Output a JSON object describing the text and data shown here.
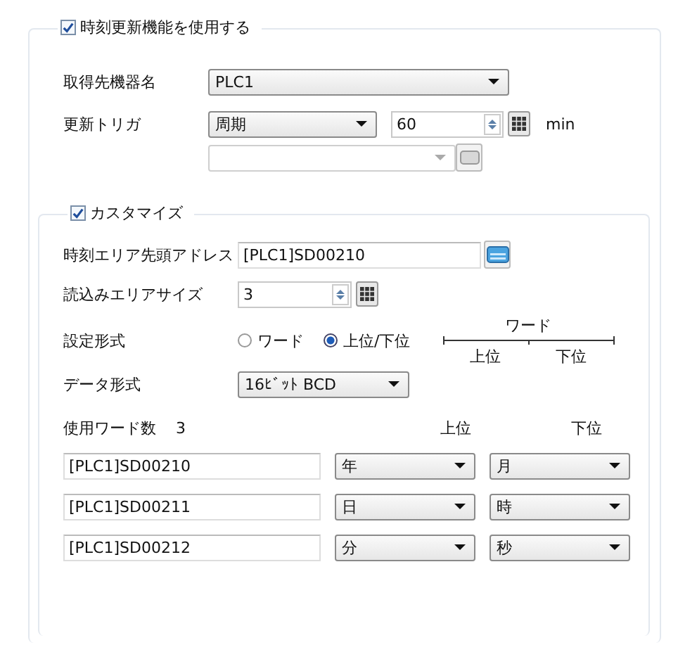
{
  "time_update": {
    "label": "時刻更新機能を使用する",
    "checked": true,
    "source_device": {
      "label": "取得先機器名",
      "value": "PLC1"
    },
    "trigger": {
      "label": "更新トリガ",
      "value": "周期",
      "interval": "60",
      "unit": "min",
      "secondary_disabled": true
    },
    "customize": {
      "label": "カスタマイズ",
      "checked": true,
      "start_address": {
        "label": "時刻エリア先頭アドレス",
        "value": "[PLC1]SD00210"
      },
      "read_size": {
        "label": "読込みエリアサイズ",
        "value": "3"
      },
      "setting_format": {
        "label": "設定形式",
        "options": [
          {
            "label": "ワード",
            "selected": false
          },
          {
            "label": "上位/下位",
            "selected": true
          }
        ],
        "diagram": {
          "word": "ワード",
          "upper": "上位",
          "lower": "下位"
        }
      },
      "data_format": {
        "label": "データ形式",
        "value": "16ﾋﾞｯﾄ BCD"
      },
      "words": {
        "label": "使用ワード数",
        "count": "3",
        "upper_heading": "上位",
        "lower_heading": "下位",
        "rows": [
          {
            "address": "[PLC1]SD00210",
            "upper": "年",
            "lower": "月"
          },
          {
            "address": "[PLC1]SD00211",
            "upper": "日",
            "lower": "時"
          },
          {
            "address": "[PLC1]SD00212",
            "upper": "分",
            "lower": "秒"
          }
        ]
      }
    }
  }
}
